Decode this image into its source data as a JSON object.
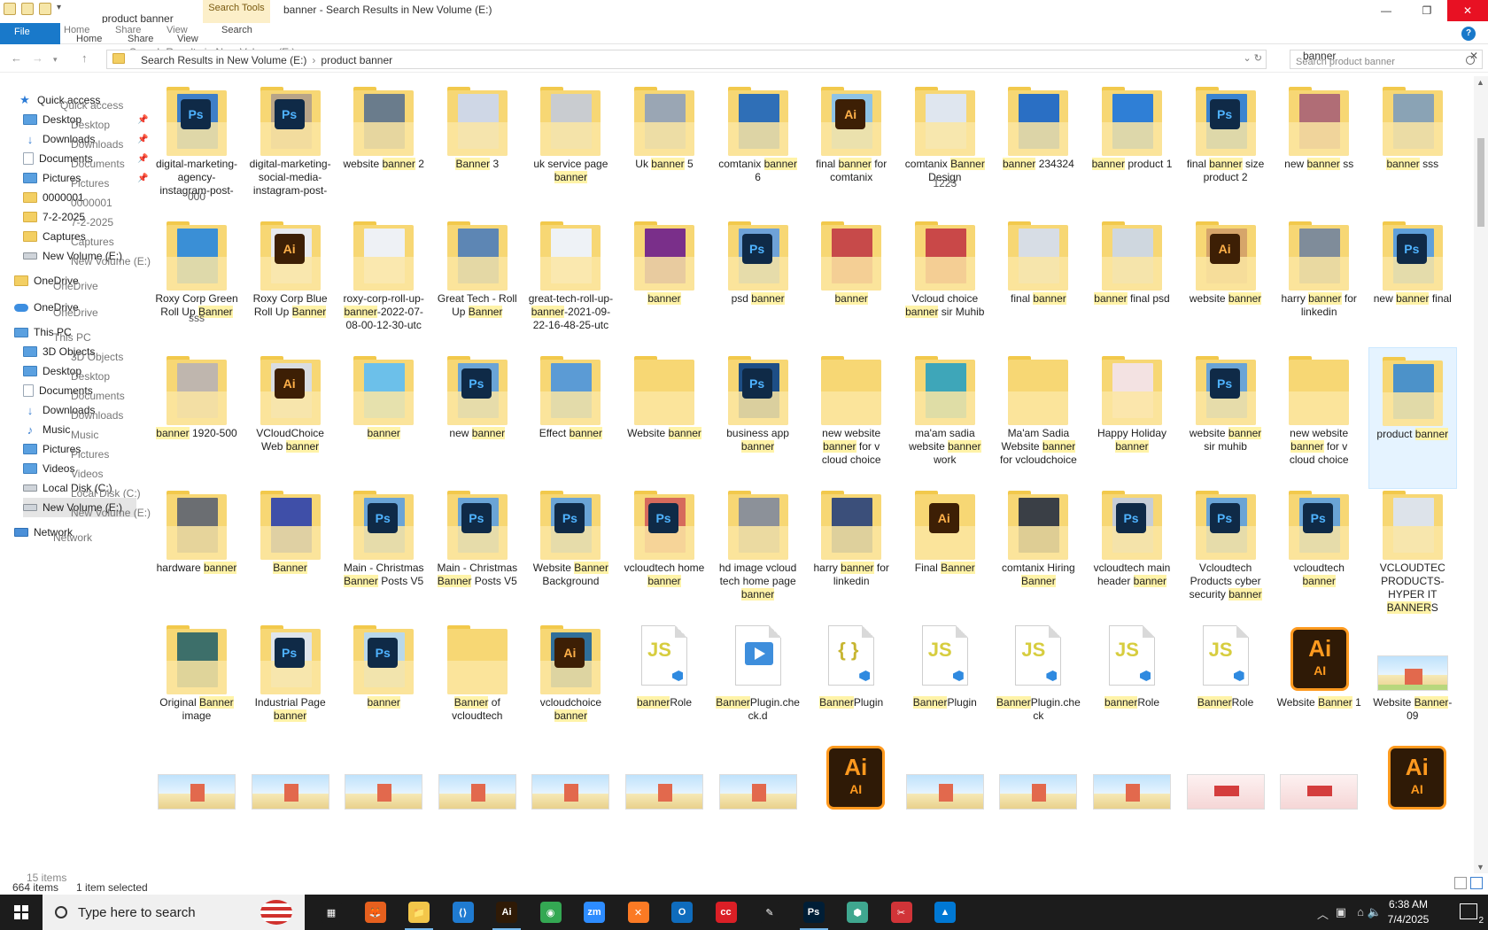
{
  "window": {
    "title": "banner - Search Results in New Volume (E:)",
    "qat_label": "product banner",
    "search_tools_tab": "Search Tools",
    "controls": [
      "—",
      "❐",
      "✕"
    ]
  },
  "ribbon": {
    "file": "File",
    "tabs": [
      "Home",
      "Share",
      "View",
      "Search"
    ],
    "ghost_tabs": [
      "Home",
      "Share",
      "View"
    ]
  },
  "address": {
    "ghost": "Search Results in New Volume (E:)",
    "crumbs": [
      "Search Results in New Volume (E:)",
      "product banner"
    ]
  },
  "search": {
    "value": "banner",
    "placeholder": "Search product banner"
  },
  "nav": [
    {
      "label": "Quick access",
      "icon": "star",
      "ghost": "Quick access"
    },
    {
      "label": "Desktop",
      "icon": "blue",
      "ghost": "Desktop",
      "pin": true
    },
    {
      "label": "Downloads",
      "icon": "down",
      "ghost": "Downloads",
      "pin": true
    },
    {
      "label": "Documents",
      "icon": "doc",
      "ghost": "Documents",
      "pin": true
    },
    {
      "label": "Pictures",
      "icon": "blue",
      "ghost": "Pictures",
      "pin": true
    },
    {
      "label": "0000001",
      "icon": "folder",
      "ghost": "0000001"
    },
    {
      "label": "7-2-2025",
      "icon": "folder",
      "ghost": "7-2-2025"
    },
    {
      "label": "Captures",
      "icon": "folder",
      "ghost": "Captures"
    },
    {
      "label": "New Volume (E:)",
      "icon": "drive",
      "ghost": "New Volume (E:)"
    },
    {
      "label": "OneDrive",
      "icon": "folder",
      "ghost": "OneDrive"
    },
    {
      "label": "OneDrive",
      "icon": "cloud",
      "ghost": "OneDrive"
    },
    {
      "label": "This PC",
      "icon": "pc",
      "ghost": "This PC"
    },
    {
      "label": "3D Objects",
      "icon": "blue",
      "ghost": "3D Objects"
    },
    {
      "label": "Desktop",
      "icon": "blue",
      "ghost": "Desktop"
    },
    {
      "label": "Documents",
      "icon": "doc",
      "ghost": "Documents"
    },
    {
      "label": "Downloads",
      "icon": "down",
      "ghost": "Downloads"
    },
    {
      "label": "Music",
      "icon": "music",
      "ghost": "Music"
    },
    {
      "label": "Pictures",
      "icon": "blue",
      "ghost": "Pictures"
    },
    {
      "label": "Videos",
      "icon": "blue",
      "ghost": "Videos"
    },
    {
      "label": "Local Disk (C:)",
      "icon": "drive",
      "ghost": "Local Disk (C:)"
    },
    {
      "label": "New Volume (E:)",
      "icon": "drive",
      "ghost": "New Volume (E:)",
      "selected": true
    },
    {
      "label": "Network",
      "icon": "net",
      "ghost": "Network"
    }
  ],
  "rows": [
    [
      {
        "t": "ps",
        "p": "#3e7fc8",
        "label": "digital-marketing-agency-instagram-post-",
        "ghost": "000"
      },
      {
        "t": "ps",
        "p": "#b8a488",
        "label": "digital-marketing-social-media-instagram-post-",
        "ghost": ""
      },
      {
        "t": "f",
        "p": "#6a7c8c",
        "label": "website banner 2",
        "ghost": ""
      },
      {
        "t": "f",
        "p": "#cfd7e6",
        "label": "Banner 3",
        "ghost": ""
      },
      {
        "t": "f",
        "p": "#c9ccd0",
        "label": "uk service page banner",
        "ghost": ""
      },
      {
        "t": "f",
        "p": "#9aa6b4",
        "label": "Uk banner 5",
        "ghost": ""
      },
      {
        "t": "f",
        "p": "#2f6fb7",
        "label": "comtanix banner 6",
        "ghost": ""
      },
      {
        "t": "ai",
        "p": "#8ec3e6",
        "label": "final banner for comtanix",
        "ghost": ""
      },
      {
        "t": "f",
        "p": "#dfe6ef",
        "label": "comtanix Banner Design",
        "ghost": "1223"
      },
      {
        "t": "f",
        "p": "#2a6fc4",
        "label": "banner 234324",
        "ghost": ""
      },
      {
        "t": "f",
        "p": "#2f7fd6",
        "label": "banner product 1",
        "ghost": ""
      },
      {
        "t": "ps",
        "p": "#3b84d0",
        "label": "final banner size product 2",
        "ghost": ""
      },
      {
        "t": "f",
        "p": "#b06d76",
        "label": "new banner ss",
        "ghost": ""
      },
      {
        "t": "f",
        "p": "#8aa3b5",
        "label": "banner sss",
        "ghost": ""
      }
    ],
    [
      {
        "t": "f",
        "p": "#3a8fd6",
        "label": "Roxy Corp Green Roll Up Banner",
        "ghost": "sss"
      },
      {
        "t": "ai",
        "p": "#e8eaee",
        "label": "Roxy Corp Blue Roll Up Banner",
        "ghost": ""
      },
      {
        "t": "f",
        "p": "#eef1f5",
        "label": "roxy-corp-roll-up-banner-2022-07-08-00-12-30-utc",
        "ghost": ""
      },
      {
        "t": "f",
        "p": "#5d86b4",
        "label": "Great Tech - Roll Up Banner",
        "ghost": ""
      },
      {
        "t": "f",
        "p": "#eef2f6",
        "label": "great-tech-roll-up-banner-2021-09-22-16-48-25-utc",
        "ghost": ""
      },
      {
        "t": "f",
        "p": "#7a2f8a",
        "label": "banner",
        "ghost": ""
      },
      {
        "t": "ps",
        "p": "#6ea2d8",
        "label": "psd banner",
        "ghost": ""
      },
      {
        "t": "f",
        "p": "#c74a4a",
        "label": "banner",
        "ghost": ""
      },
      {
        "t": "f",
        "p": "#c94848",
        "label": "Vcloud choice banner sir Muhib",
        "ghost": ""
      },
      {
        "t": "f",
        "p": "#d7dde5",
        "label": "final banner",
        "ghost": ""
      },
      {
        "t": "f",
        "p": "#cfd7df",
        "label": "banner final psd",
        "ghost": ""
      },
      {
        "t": "ai",
        "p": "#d6a56a",
        "label": "website banner",
        "ghost": ""
      },
      {
        "t": "f",
        "p": "#7f8c9a",
        "label": "harry banner for linkedin",
        "ghost": ""
      },
      {
        "t": "ps",
        "p": "#5fa0da",
        "label": "new banner final",
        "ghost": ""
      }
    ],
    [
      {
        "t": "f",
        "p": "#bfb6ae",
        "label": "banner 1920-500",
        "ghost": ""
      },
      {
        "t": "ai",
        "p": "#d9dde2",
        "label": "VCloudChoice Web banner",
        "ghost": ""
      },
      {
        "t": "f",
        "p": "#6cc0ea",
        "label": "banner",
        "ghost": ""
      },
      {
        "t": "ps",
        "p": "#6aa4d6",
        "label": "new banner",
        "ghost": ""
      },
      {
        "t": "f",
        "p": "#5b9bd5",
        "label": "Effect banner",
        "ghost": ""
      },
      {
        "t": "f",
        "p": "#f7d774",
        "label": "Website banner",
        "ghost": ""
      },
      {
        "t": "ps",
        "p": "#1d4e86",
        "label": "business app banner",
        "ghost": ""
      },
      {
        "t": "f",
        "p": "#f7d774",
        "label": "new website banner for v cloud choice",
        "ghost": ""
      },
      {
        "t": "f",
        "p": "#3ea6b9",
        "label": "ma'am sadia website banner work",
        "ghost": ""
      },
      {
        "t": "f",
        "p": "#f7d774",
        "label": "Ma'am Sadia Website banner for vcloudchoice",
        "ghost": ""
      },
      {
        "t": "f",
        "p": "#f3e2e2",
        "label": "Happy Holiday banner",
        "ghost": ""
      },
      {
        "t": "ps",
        "p": "#6aa4d6",
        "label": "website banner sir muhib",
        "ghost": ""
      },
      {
        "t": "f",
        "p": "#f7d774",
        "label": "new website banner for v cloud choice",
        "ghost": ""
      },
      {
        "t": "f",
        "p": "#4c92c9",
        "label": "product banner",
        "ghost": "",
        "selected": true
      }
    ],
    [
      {
        "t": "f",
        "p": "#6b6e72",
        "label": "hardware banner",
        "ghost": ""
      },
      {
        "t": "f",
        "p": "#3f4fa8",
        "label": "Banner",
        "ghost": ""
      },
      {
        "t": "ps",
        "p": "#6aa4d6",
        "label": "Main - Christmas Banner Posts V5",
        "ghost": ""
      },
      {
        "t": "ps",
        "p": "#6aa4d6",
        "label": "Main - Christmas Banner Posts V5",
        "ghost": ""
      },
      {
        "t": "ps",
        "p": "#6aa4d6",
        "label": "Website Banner Background",
        "ghost": ""
      },
      {
        "t": "ps",
        "p": "#d66a5c",
        "label": "vcloudtech home banner",
        "ghost": ""
      },
      {
        "t": "f",
        "p": "#8c9199",
        "label": "hd image vcloud tech home page banner",
        "ghost": ""
      },
      {
        "t": "f",
        "p": "#3b4f7a",
        "label": "harry banner for linkedin",
        "ghost": ""
      },
      {
        "t": "ai",
        "p": "#f7d774",
        "label": "Final Banner",
        "ghost": ""
      },
      {
        "t": "f",
        "p": "#3a3f46",
        "label": "comtanix Hiring Banner",
        "ghost": ""
      },
      {
        "t": "ps",
        "p": "#c6cdd6",
        "label": "vcloudtech main header banner",
        "ghost": ""
      },
      {
        "t": "ps",
        "p": "#6aa4d6",
        "label": "Vcloudtech Products cyber security banner",
        "ghost": ""
      },
      {
        "t": "ps",
        "p": "#6aa4d6",
        "label": "vcloudtech banner",
        "ghost": ""
      },
      {
        "t": "f",
        "p": "#dde3ea",
        "label": "VCLOUDTEC PRODUCTS-HYPER IT BANNERS",
        "ghost": ""
      }
    ],
    [
      {
        "t": "f",
        "p": "#3d6f6a",
        "label": "Original Banner image",
        "ghost": ""
      },
      {
        "t": "ps",
        "p": "#dfe5ec",
        "label": "Industrial Page banner",
        "ghost": ""
      },
      {
        "t": "ps",
        "p": "#b9d8ea",
        "label": "banner",
        "ghost": ""
      },
      {
        "t": "f",
        "p": "#f7d774",
        "label": "Banner of vcloudtech",
        "ghost": ""
      },
      {
        "t": "ai",
        "p": "#2f6f9a",
        "label": "vcloudchoice banner",
        "ghost": ""
      },
      {
        "t": "js",
        "label": "bannerRole",
        "ghost": ""
      },
      {
        "t": "d",
        "label": "BannerPlugin.check.d",
        "ghost": ""
      },
      {
        "t": "json",
        "label": "BannerPlugin",
        "ghost": ""
      },
      {
        "t": "js",
        "label": "BannerPlugin",
        "ghost": ""
      },
      {
        "t": "js",
        "label": "BannerPlugin.check",
        "ghost": ""
      },
      {
        "t": "js",
        "label": "bannerRole",
        "ghost": ""
      },
      {
        "t": "js",
        "label": "BannerRole",
        "ghost": ""
      },
      {
        "t": "aifile",
        "label": "Website Banner 1",
        "ghost": ""
      },
      {
        "t": "img",
        "label": "Website Banner-09",
        "ghost": ""
      }
    ]
  ],
  "ai_badge": {
    "big": "Ai",
    "small": "AI"
  },
  "ps_badge": "Ps",
  "status": {
    "count": "664 items",
    "ghost_count": "15 items",
    "selected": "1 item selected"
  },
  "taskbar": {
    "search_placeholder": "Type here to search",
    "time": "6:38 AM",
    "date": "7/4/2025",
    "notif_count": "2",
    "apps": [
      {
        "name": "task-view",
        "color": "#1c1c1c",
        "glyph": "▦"
      },
      {
        "name": "firefox",
        "color": "#e6601e",
        "glyph": "🦊"
      },
      {
        "name": "file-explorer",
        "color": "#f3c64a",
        "glyph": "📁"
      },
      {
        "name": "vscode",
        "color": "#1f7bd1",
        "glyph": "⟨⟩"
      },
      {
        "name": "illustrator",
        "color": "#2f1a06",
        "glyph": "Ai"
      },
      {
        "name": "chrome",
        "color": "#34a853",
        "glyph": "◉"
      },
      {
        "name": "zoom",
        "color": "#2d8cff",
        "glyph": "zm"
      },
      {
        "name": "xampp",
        "color": "#fb7a24",
        "glyph": "✕"
      },
      {
        "name": "outlook",
        "color": "#0f6cbd",
        "glyph": "O"
      },
      {
        "name": "creative-cloud",
        "color": "#da1f26",
        "glyph": "cc"
      },
      {
        "name": "pen-tool",
        "color": "#1c1c1c",
        "glyph": "✎"
      },
      {
        "name": "photoshop",
        "color": "#001e36",
        "glyph": "Ps"
      },
      {
        "name": "app-hex",
        "color": "#3fa78f",
        "glyph": "⬢"
      },
      {
        "name": "snip-tool",
        "color": "#d13438",
        "glyph": "✂"
      },
      {
        "name": "photos",
        "color": "#0078d4",
        "glyph": "▲"
      }
    ]
  }
}
